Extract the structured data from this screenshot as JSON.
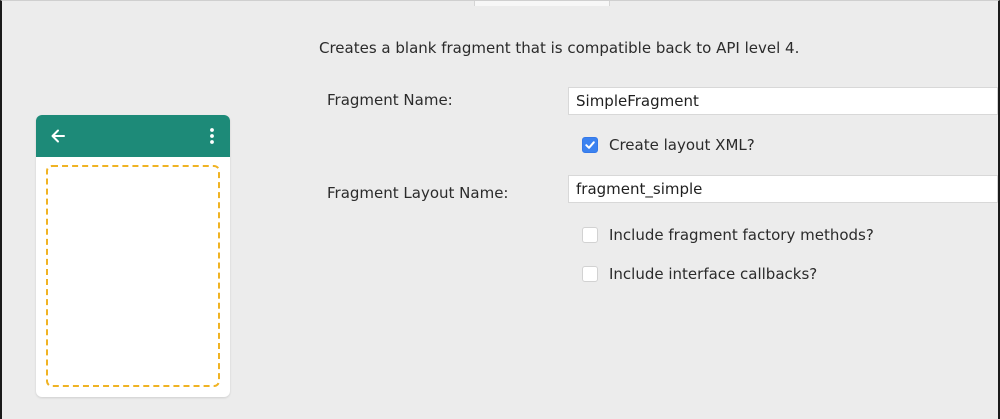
{
  "dialog": {
    "description": "Creates a blank fragment that is compatible back to API level 4."
  },
  "preview": {
    "toolbar_color": "#1d8a78",
    "placeholder_color": "#f0b323",
    "icons": [
      "back-arrow-icon",
      "more-vert-icon"
    ]
  },
  "form": {
    "fragment_name": {
      "label": "Fragment Name:",
      "value": "SimpleFragment"
    },
    "create_layout_xml": {
      "label": "Create layout XML?",
      "checked": true
    },
    "fragment_layout_name": {
      "label": "Fragment Layout Name:",
      "value": "fragment_simple"
    },
    "include_factory_methods": {
      "label": "Include fragment factory methods?",
      "checked": false
    },
    "include_interface_callbacks": {
      "label": "Include interface callbacks?",
      "checked": false
    }
  },
  "colors": {
    "checkbox_checked": "#3b82f0",
    "background": "#ececec"
  }
}
